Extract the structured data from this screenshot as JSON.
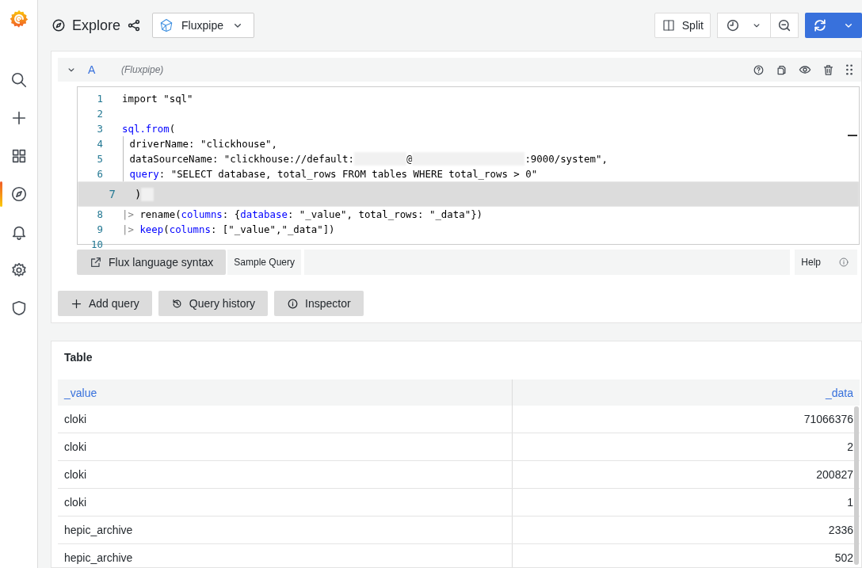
{
  "sidebar": {
    "items": [
      {
        "selected": false
      },
      {
        "selected": false
      },
      {
        "selected": false
      },
      {
        "selected": true
      },
      {
        "selected": false
      },
      {
        "selected": false
      },
      {
        "selected": false
      }
    ]
  },
  "toolbar": {
    "title": "Explore",
    "datasource": "Fluxpipe",
    "split": "Split"
  },
  "query": {
    "ref": "A",
    "datasource": "(Fluxpipe)",
    "lines": [
      {
        "number": "1",
        "active": false,
        "segments": [
          {
            "kind": "plain",
            "text": "import \"sql\""
          }
        ]
      },
      {
        "number": "2",
        "active": false
      },
      {
        "number": "3",
        "active": false,
        "segments": [
          {
            "kind": "ident",
            "text": "sql.from"
          },
          {
            "kind": "plain",
            "text": "("
          }
        ]
      },
      {
        "number": "4",
        "active": false,
        "segments": [
          {
            "kind": "guide"
          },
          {
            "kind": "plain",
            "text": " driverName: \"clickhouse\","
          }
        ]
      },
      {
        "number": "5",
        "active": false,
        "segments": [
          {
            "kind": "guide"
          },
          {
            "kind": "plain",
            "text": " dataSourceName: \"clickhouse://default:"
          },
          {
            "kind": "redacted"
          },
          {
            "kind": "plain",
            "text": "@"
          },
          {
            "kind": "redacted"
          },
          {
            "kind": "plain",
            "text": ":9000/system\","
          }
        ]
      },
      {
        "number": "6",
        "active": false,
        "segments": [
          {
            "kind": "guide"
          },
          {
            "kind": "ident",
            "text": " query"
          },
          {
            "kind": "plain",
            "text": ": \"SELECT database, total_rows FROM tables WHERE total_rows > 0\""
          }
        ]
      },
      {
        "number": "7",
        "active": true,
        "segments": [
          {
            "kind": "plain",
            "text": ")"
          },
          {
            "kind": "redacted"
          }
        ]
      },
      {
        "number": "8",
        "active": false,
        "segments": [
          {
            "kind": "op",
            "text": "|>"
          },
          {
            "kind": "plain",
            "text": " rename("
          },
          {
            "kind": "ident",
            "text": "columns"
          },
          {
            "kind": "plain",
            "text": ": {"
          },
          {
            "kind": "ident",
            "text": "database"
          },
          {
            "kind": "plain",
            "text": ": \"_value\", total_rows: \"_data\"})"
          }
        ]
      },
      {
        "number": "9",
        "active": false,
        "segments": [
          {
            "kind": "op",
            "text": "|>"
          },
          {
            "kind": "ident",
            "text": " keep"
          },
          {
            "kind": "plain",
            "text": "("
          },
          {
            "kind": "ident",
            "text": "columns"
          },
          {
            "kind": "plain",
            "text": ": [\"_value\",\"_data\"])"
          }
        ]
      },
      {
        "number": "10",
        "active": false
      }
    ],
    "syntax_link": "Flux language syntax",
    "sample": "Sample Query",
    "help": "Help"
  },
  "actions": [
    {
      "label": "Add query"
    },
    {
      "label": "Query history"
    },
    {
      "label": "Inspector"
    }
  ],
  "table": {
    "title": "Table",
    "columns": [
      "_value",
      "_data"
    ],
    "rows": [
      [
        "cloki",
        "71066376"
      ],
      [
        "cloki",
        "2"
      ],
      [
        "cloki",
        "200827"
      ],
      [
        "cloki",
        "1"
      ],
      [
        "hepic_archive",
        "2336"
      ],
      [
        "hepic_archive",
        "502"
      ]
    ]
  }
}
